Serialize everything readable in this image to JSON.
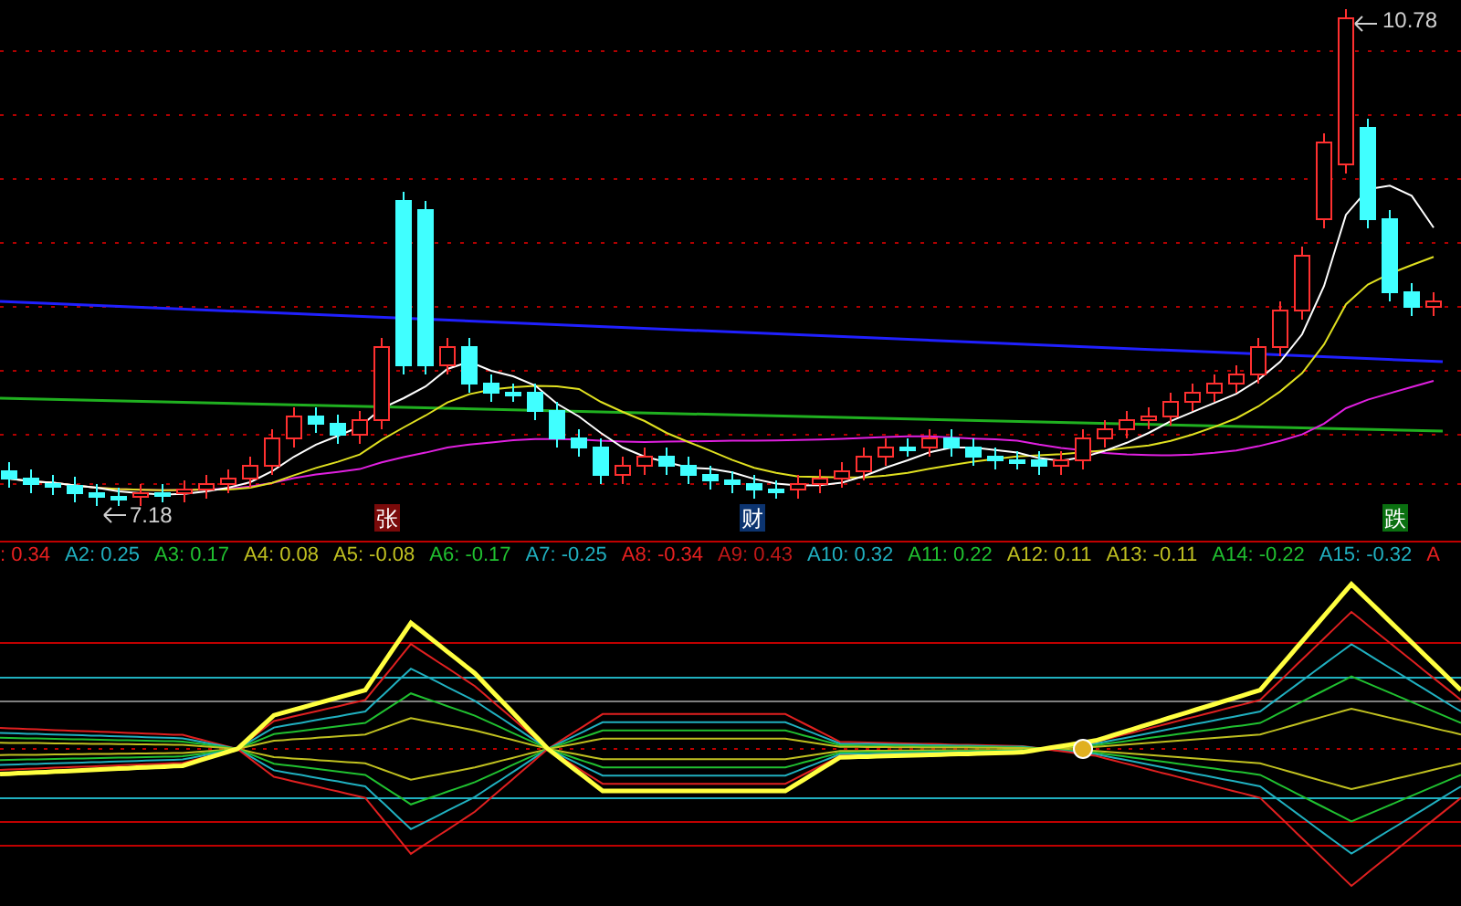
{
  "price_chart": {
    "high_label": "10.78",
    "low_label": "7.18",
    "signals": [
      {
        "text": "张",
        "color": "#7a0a0a"
      },
      {
        "text": "财",
        "color": "#0c3470"
      },
      {
        "text": "跌",
        "color": "#0a7010"
      }
    ]
  },
  "indicator": {
    "values": [
      {
        "text": ": 0.34",
        "color": "#e82020"
      },
      {
        "text": "A2: 0.25",
        "color": "#20b0c0"
      },
      {
        "text": "A3: 0.17",
        "color": "#20c030"
      },
      {
        "text": "A4: 0.08",
        "color": "#c0c020"
      },
      {
        "text": "A5: -0.08",
        "color": "#c0c020"
      },
      {
        "text": "A6: -0.17",
        "color": "#20c030"
      },
      {
        "text": "A7: -0.25",
        "color": "#20b0c0"
      },
      {
        "text": "A8: -0.34",
        "color": "#e82020"
      },
      {
        "text": "A9: 0.43",
        "color": "#c01818"
      },
      {
        "text": "A10: 0.32",
        "color": "#20b0c0"
      },
      {
        "text": "A11: 0.22",
        "color": "#20c030"
      },
      {
        "text": "A12: 0.11",
        "color": "#c0c020"
      },
      {
        "text": "A13: -0.11",
        "color": "#c0c020"
      },
      {
        "text": "A14: -0.22",
        "color": "#20c030"
      },
      {
        "text": "A15: -0.32",
        "color": "#20b0c0"
      },
      {
        "text": "A",
        "color": "#e82020"
      }
    ]
  }
}
